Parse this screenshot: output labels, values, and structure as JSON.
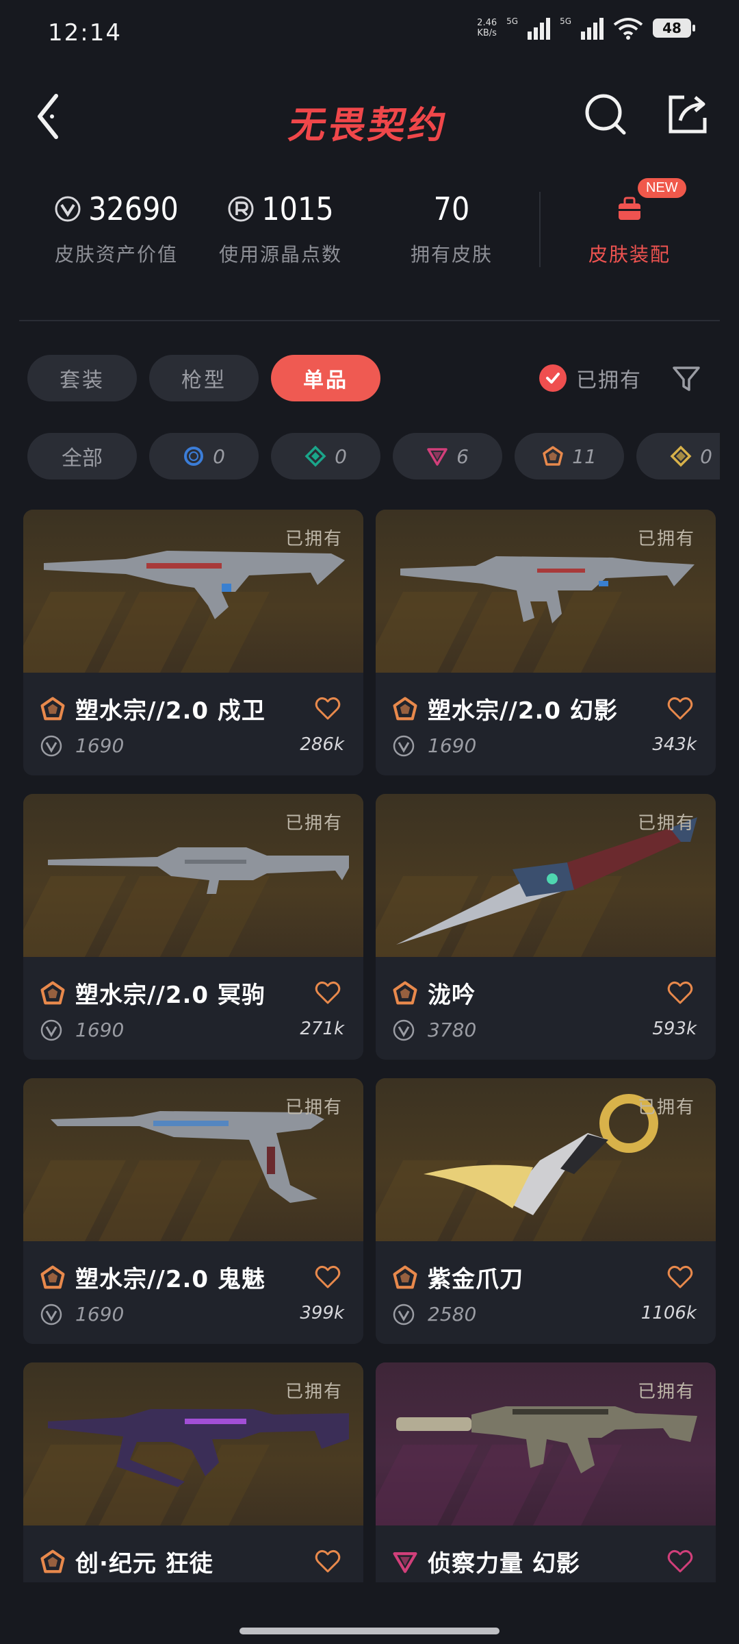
{
  "status_bar": {
    "time": "12:14",
    "net_speed_value": "2.46",
    "net_speed_unit": "KB/s",
    "sig1": "5G",
    "sig2": "5G",
    "battery": "48"
  },
  "nav": {
    "title": "无畏契约"
  },
  "stats": {
    "asset_value": "32690",
    "asset_label": "皮肤资产价值",
    "radianite_value": "1015",
    "radianite_label": "使用源晶点数",
    "owned_value": "70",
    "owned_label": "拥有皮肤",
    "loadout_label": "皮肤装配",
    "new_badge": "NEW"
  },
  "tabs": [
    {
      "label": "套装",
      "active": false
    },
    {
      "label": "枪型",
      "active": false
    },
    {
      "label": "单品",
      "active": true
    }
  ],
  "owned_filter_label": "已拥有",
  "tiers": {
    "all_label": "全部",
    "items": [
      {
        "icon": "select-tier-icon",
        "count": "0",
        "color": "#3b7dd8"
      },
      {
        "icon": "deluxe-tier-icon",
        "count": "0",
        "color": "#1aa58a"
      },
      {
        "icon": "premium-tier-icon",
        "count": "6",
        "color": "#d13f7a"
      },
      {
        "icon": "exclusive-tier-icon",
        "count": "11",
        "color": "#e8894c"
      },
      {
        "icon": "ultra-tier-icon",
        "count": "0",
        "color": "#d8b24a"
      }
    ]
  },
  "colors": {
    "accent": "#ef5a52",
    "exclusive": "#e8894c",
    "premium": "#d13f7a"
  },
  "cards": [
    {
      "owned": "已拥有",
      "name": "塑水宗//2.0 戍卫",
      "price": "1690",
      "likes": "286k",
      "tier": "exclusive-tier-icon",
      "weapon": "rifle-guardian"
    },
    {
      "owned": "已拥有",
      "name": "塑水宗//2.0 幻影",
      "price": "1690",
      "likes": "343k",
      "tier": "exclusive-tier-icon",
      "weapon": "rifle-phantom"
    },
    {
      "owned": "已拥有",
      "name": "塑水宗//2.0 冥驹",
      "price": "1690",
      "likes": "271k",
      "tier": "exclusive-tier-icon",
      "weapon": "sniper-marshal"
    },
    {
      "owned": "已拥有",
      "name": "泷吟",
      "price": "3780",
      "likes": "593k",
      "tier": "exclusive-tier-icon",
      "weapon": "knife-kunai"
    },
    {
      "owned": "已拥有",
      "name": "塑水宗//2.0 鬼魅",
      "price": "1690",
      "likes": "399k",
      "tier": "exclusive-tier-icon",
      "weapon": "pistol-ghost"
    },
    {
      "owned": "已拥有",
      "name": "紫金爪刀",
      "price": "2580",
      "likes": "1106k",
      "tier": "exclusive-tier-icon",
      "weapon": "knife-karambit"
    },
    {
      "owned": "已拥有",
      "name": "创·纪元 狂徒",
      "price": "",
      "likes": "",
      "tier": "exclusive-tier-icon",
      "weapon": "rifle-vandal"
    },
    {
      "owned": "已拥有",
      "name": "侦察力量 幻影",
      "price": "",
      "likes": "",
      "tier": "premium-tier-icon",
      "weapon": "rifle-phantom-recon"
    }
  ]
}
